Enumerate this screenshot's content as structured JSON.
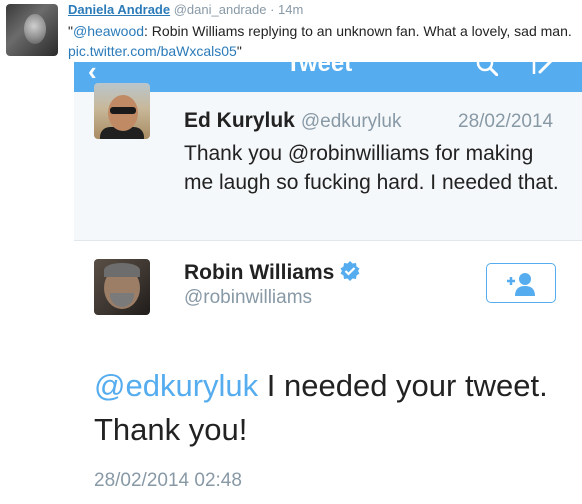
{
  "outer_tweet": {
    "name": "Daniela Andrade",
    "handle": "@dani_andrade",
    "separator": "·",
    "time": "14m",
    "text_open_quote": "\"",
    "text_mention": "@heawood",
    "text_body": ": Robin Williams replying to an unknown fan. What a lovely, sad man. ",
    "text_link": "pic.twitter.com/baWxcals05",
    "text_close_quote": "\""
  },
  "screenshot": {
    "nav": {
      "title": "Tweet",
      "back_icon": "back-arrow-icon",
      "search_icon": "search-icon",
      "compose_icon": "compose-icon",
      "color": "#55acee"
    },
    "reply_to": {
      "name": "Ed Kuryluk",
      "handle": "@edkuryluk",
      "date": "28/02/2014",
      "text": "Thank you @robinwilliams for making me laugh so fucking hard. I needed that."
    },
    "tweet": {
      "name": "Robin Williams",
      "handle": "@robinwilliams",
      "verified": true,
      "follow_icon": "follow-user-icon",
      "mention": "@edkuryluk",
      "text": " I needed your tweet. Thank you!",
      "timestamp": "28/02/2014 02:48"
    }
  }
}
